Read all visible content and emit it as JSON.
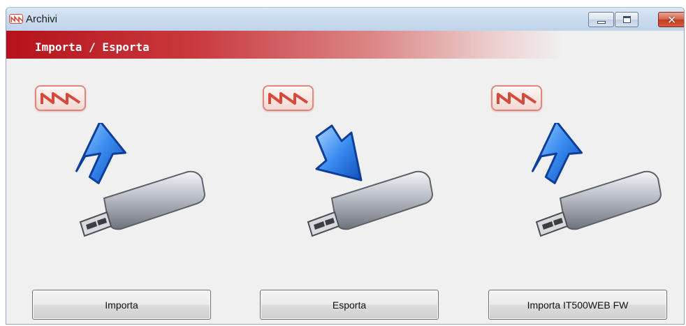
{
  "window": {
    "title": "Archivi",
    "controls": [
      "minimize",
      "maximize",
      "close"
    ]
  },
  "section": {
    "title": "Importa / Esporta",
    "accent_color": "#b5121b"
  },
  "panels": [
    {
      "icon": "usb-import-icon",
      "arrow": "up",
      "button_label": "Importa"
    },
    {
      "icon": "usb-export-icon",
      "arrow": "down",
      "button_label": "Esporta"
    },
    {
      "icon": "usb-firmware-import-icon",
      "arrow": "up",
      "button_label": "Importa IT500WEB FW"
    }
  ],
  "colors": {
    "titlebar": "#cbdcef",
    "arrow_blue": "#2f7fe0",
    "badge_red": "#e0877d"
  }
}
